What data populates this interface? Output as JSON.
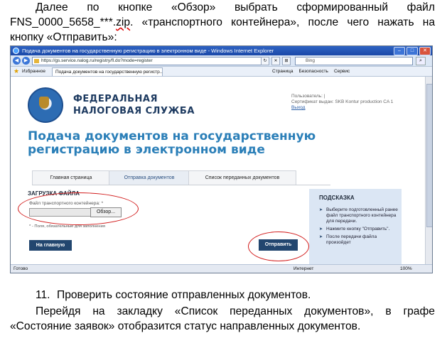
{
  "doc": {
    "p1_a": "Далее по кнопке «Обзор» выбрать сформированный файл FNS_0000_5658_***.",
    "p1_squig": "zip",
    "p1_b": ". «транспортного контейнера», после чего нажать на кнопку «Отправить»:",
    "item_number": "11.",
    "item_text": "Проверить состояние отправленных документов.",
    "p3": "Перейдя на закладку «Список переданных документов», в графе «Состояние заявок» отобразится статус направленных документов."
  },
  "browser": {
    "title": "Подача документов на государственную регистрацию в электронном виде - Windows Internet Explorer",
    "url": "https://gs.service.nalog.ru/registry/fl.do?mode=register",
    "search_placeholder": "Bing",
    "favorites_label": "Избранное",
    "tab_title": "Подача документов на государственную регистр...",
    "cmd_items": [
      "Страница",
      "Безопасность",
      "Сервис"
    ],
    "status_left": "Готово",
    "status_zone": "Интернет",
    "zoom": "100%"
  },
  "page": {
    "org_line1": "ФЕДЕРАЛЬНАЯ",
    "org_line2": "НАЛОГОВАЯ СЛУЖБА",
    "user_label": "Пользователь: |",
    "cert_label": "Сертификат выдан: SKB Kontur production CA 1",
    "logout": "Выход",
    "heading": "Подача документов на государственную регистрацию в электронном виде",
    "tabs": [
      "Главная страница",
      "Отправка документов",
      "Список переданных документов"
    ],
    "active_tab": 1,
    "upload_title": "ЗАГРУЗКА ФАЙЛА",
    "field_label": "Файл транспортного контейнера: *",
    "browse_label": "Обзор...",
    "required_note": "* - Поля, обязательные для заполнения",
    "home_button": "На главную",
    "send_button": "Отправить",
    "hint_title": "ПОДСКАЗКА",
    "hints": [
      "Выберите подготовленный ранее файл транспортного контейнера для передачи.",
      "Нажмите кнопку \"Отправить\".",
      "После передачи файла произойдет"
    ]
  },
  "colors": {
    "highlight": "#d21c1c",
    "button": "#22466f",
    "heading": "#2b7fb8"
  }
}
